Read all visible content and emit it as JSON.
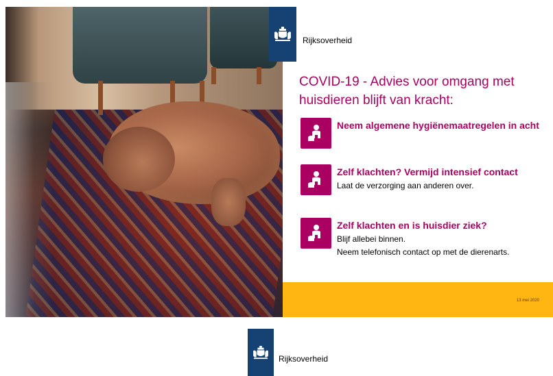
{
  "brand": {
    "name": "Rijksoverheid",
    "color_logo_block": "#154273"
  },
  "headline": "COVID-19 - Advies voor omgang met huisdieren blijft van kracht:",
  "colors": {
    "accent": "#a90061",
    "stripe": "#ffb612"
  },
  "items": [
    {
      "icon": "person-with-dog-icon",
      "title": "Neem algemene hygiënemaatregelen in acht",
      "lines": []
    },
    {
      "icon": "person-with-dog-icon",
      "title": "Zelf klachten? Vermijd intensief contact",
      "lines": [
        "Laat de verzorging aan anderen over."
      ]
    },
    {
      "icon": "person-with-dog-icon",
      "title": "Zelf klachten en is huisdier ziek?",
      "lines": [
        "Blijf allebei binnen.",
        "Neem telefonisch contact op met de dierenarts."
      ]
    }
  ],
  "footer": {
    "date": "13 mei 2020"
  }
}
